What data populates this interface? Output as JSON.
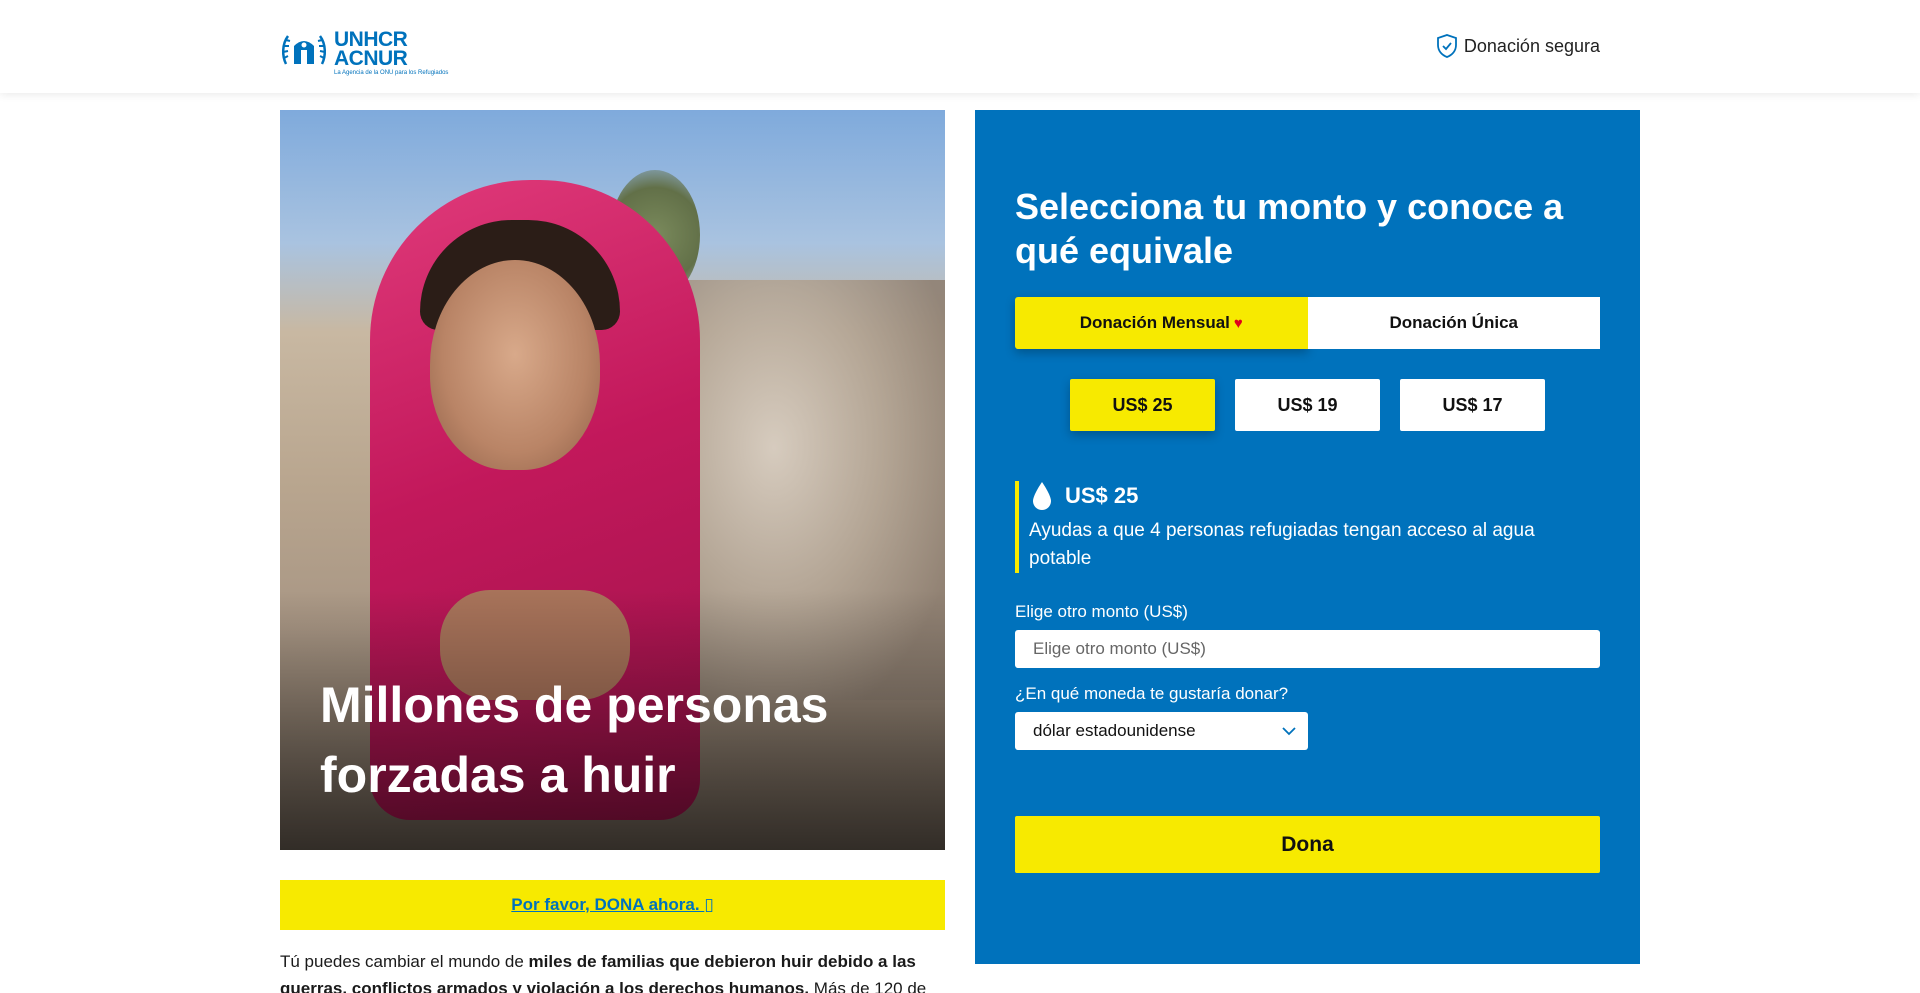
{
  "header": {
    "logo": {
      "line1": "UNHCR",
      "line2": "ACNUR",
      "tagline": "La Agencia de la ONU para los Refugiados"
    },
    "secure_label": "Donación segura"
  },
  "hero": {
    "title": "Millones de personas forzadas a huir"
  },
  "dona_now": {
    "label": "Por favor, DONA ahora. ",
    "icon_glyph": "▯"
  },
  "body_text": {
    "part1": "Tú puedes cambiar el mundo de ",
    "bold1": "miles de familias que debieron huir debido a las guerras, conflictos armados y violación a los derechos humanos.",
    "part2": " Más de 120 de"
  },
  "panel": {
    "title": "Selecciona tu monto y conoce a qué equivale",
    "frequency": {
      "monthly_label": "Donación Mensual",
      "monthly_heart": "♥",
      "single_label": "Donación Única",
      "selected": "monthly"
    },
    "amounts": [
      "US$ 25",
      "US$ 19",
      "US$ 17"
    ],
    "selected_amount": "US$ 25",
    "impact": {
      "icon": "water-drop-icon",
      "amount": "US$ 25",
      "description": "Ayudas a que 4 personas refugiadas tengan acceso al agua potable"
    },
    "other_amount": {
      "label": "Elige otro monto (US$)",
      "placeholder": "Elige otro monto (US$)",
      "value": ""
    },
    "currency": {
      "label": "¿En qué moneda te gustaría donar?",
      "selected": "dólar estadounidense"
    },
    "donate_label": "Dona"
  },
  "colors": {
    "brand_blue": "#0072bc",
    "accent_yellow": "#f7ea00",
    "heart_red": "#e0001b"
  }
}
